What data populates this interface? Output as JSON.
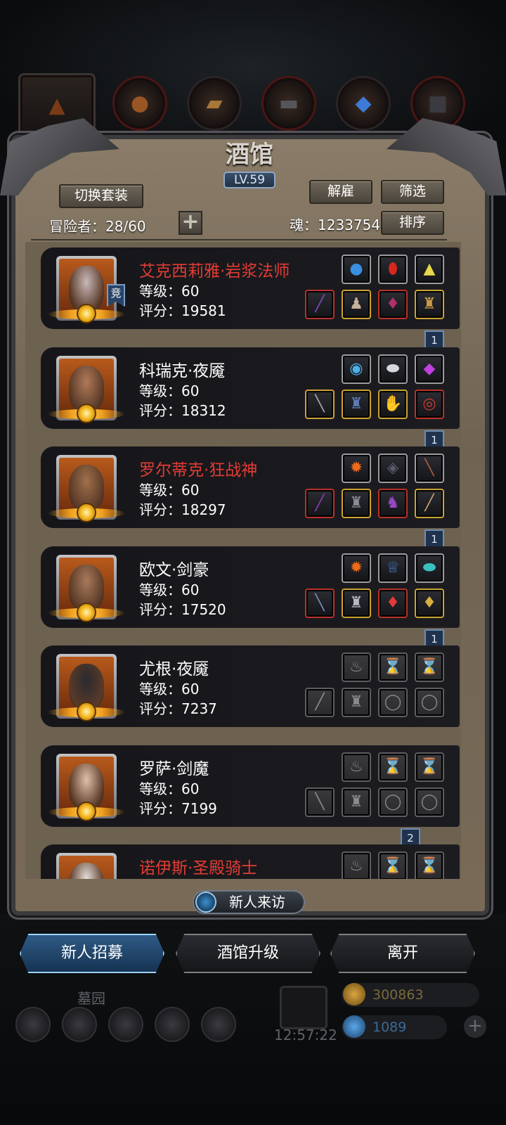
{
  "window": {
    "title": "酒馆",
    "level_badge": "LV.59"
  },
  "top_slots": [
    "hood-icon",
    "leather-icon",
    "wood-icon",
    "iron-icon",
    "crystal-icon",
    "anvil-icon"
  ],
  "toolbar": {
    "switch_outfit": "切换套装",
    "dismiss": "解雇",
    "filter": "筛选",
    "sort": "排序",
    "adventurers_label": "冒险者：28/60",
    "soul_label": "魂：1233754"
  },
  "heroes": [
    {
      "name": "艾克西莉雅·岩浆法师",
      "name_red": true,
      "level": "等级：60",
      "score": "评分：19581",
      "ribbon": "1",
      "top_items": [
        {
          "icon": "sapphire-orb-icon",
          "border": "normal"
        },
        {
          "icon": "ruby-gem-icon",
          "border": "normal"
        },
        {
          "icon": "prism-crystal-icon",
          "border": "normal"
        }
      ],
      "bottom_items": [
        {
          "icon": "staff-icon",
          "border": "red"
        },
        {
          "icon": "robe-icon",
          "border": "gold"
        },
        {
          "icon": "amulet-icon",
          "border": "red"
        },
        {
          "icon": "armor-icon",
          "border": "gold"
        }
      ]
    },
    {
      "name": "科瑞克·夜魇",
      "name_red": false,
      "level": "等级：60",
      "score": "评分：18312",
      "ribbon": "1",
      "top_items": [
        {
          "icon": "swirl-orb-icon",
          "border": "normal"
        },
        {
          "icon": "pearl-icon",
          "border": "normal"
        },
        {
          "icon": "amethyst-icon",
          "border": "normal"
        }
      ],
      "bottom_items": [
        {
          "icon": "dagger-icon",
          "border": "gold"
        },
        {
          "icon": "chestplate-icon",
          "border": "gold"
        },
        {
          "icon": "gauntlet-icon",
          "border": "gold"
        },
        {
          "icon": "ring-icon",
          "border": "red"
        }
      ]
    },
    {
      "name": "罗尔蒂克·狂战神",
      "name_red": true,
      "level": "等级：60",
      "score": "评分：18297",
      "ribbon": "1",
      "top_items": [
        {
          "icon": "fire-orb-icon",
          "border": "normal"
        },
        {
          "icon": "rune-stone-icon",
          "border": "normal"
        },
        {
          "icon": "feather-icon",
          "border": "normal"
        }
      ],
      "bottom_items": [
        {
          "icon": "mace-icon",
          "border": "red"
        },
        {
          "icon": "heavy-armor-icon",
          "border": "gold"
        },
        {
          "icon": "horned-helm-icon",
          "border": "red"
        },
        {
          "icon": "bone-club-icon",
          "border": "gold"
        }
      ]
    },
    {
      "name": "欧文·剑豪",
      "name_red": false,
      "level": "等级：60",
      "score": "评分：17520",
      "ribbon": "1",
      "top_items": [
        {
          "icon": "fire-orb-icon",
          "border": "normal"
        },
        {
          "icon": "chalice-icon",
          "border": "normal"
        },
        {
          "icon": "turquoise-icon",
          "border": "normal"
        }
      ],
      "bottom_items": [
        {
          "icon": "sword-icon",
          "border": "red"
        },
        {
          "icon": "plate-armor-icon",
          "border": "gold"
        },
        {
          "icon": "red-charm-icon",
          "border": "red"
        },
        {
          "icon": "pendant-icon",
          "border": "gold"
        }
      ]
    },
    {
      "name": "尤根·夜魇",
      "name_red": false,
      "level": "等级：60",
      "score": "评分：7237",
      "ribbon": "",
      "top_items": [
        {
          "icon": "empty-flame-icon",
          "border": "empty"
        },
        {
          "icon": "empty-hourglass-icon",
          "border": "empty"
        },
        {
          "icon": "empty-hourglass-icon",
          "border": "empty"
        }
      ],
      "bottom_items": [
        {
          "icon": "empty-blade-icon",
          "border": "empty"
        },
        {
          "icon": "empty-armor-icon",
          "border": "empty"
        },
        {
          "icon": "empty-ring-icon",
          "border": "empty"
        },
        {
          "icon": "empty-ring-icon",
          "border": "empty"
        }
      ]
    },
    {
      "name": "罗萨·剑魔",
      "name_red": false,
      "level": "等级：60",
      "score": "评分：7199",
      "ribbon": "2",
      "top_items": [
        {
          "icon": "empty-flame-icon",
          "border": "empty"
        },
        {
          "icon": "empty-hourglass-icon",
          "border": "empty"
        },
        {
          "icon": "empty-hourglass-icon",
          "border": "empty"
        }
      ],
      "bottom_items": [
        {
          "icon": "empty-sword-icon",
          "border": "empty"
        },
        {
          "icon": "empty-armor-icon",
          "border": "empty"
        },
        {
          "icon": "empty-ring-icon",
          "border": "empty"
        },
        {
          "icon": "empty-ring-icon",
          "border": "empty"
        }
      ]
    },
    {
      "name": "诺伊斯·圣殿骑士",
      "name_red": true,
      "level": "",
      "score": "",
      "ribbon": "",
      "top_items": [
        {
          "icon": "empty-flame-icon",
          "border": "empty"
        },
        {
          "icon": "empty-hourglass-icon",
          "border": "empty"
        },
        {
          "icon": "empty-hourglass-icon",
          "border": "empty"
        }
      ],
      "bottom_items": []
    }
  ],
  "arena_tag": "竞",
  "visitor_button": "新人来访",
  "actions": {
    "recruit": "新人招募",
    "upgrade": "酒馆升级",
    "leave": "离开"
  },
  "background": {
    "graveyard": "墓园",
    "clock": "12:57:22",
    "gold": "300863",
    "gems": "1089"
  },
  "colors": {
    "accent_red": "#e23c34",
    "recruit_blue": "#4aa8ff"
  }
}
